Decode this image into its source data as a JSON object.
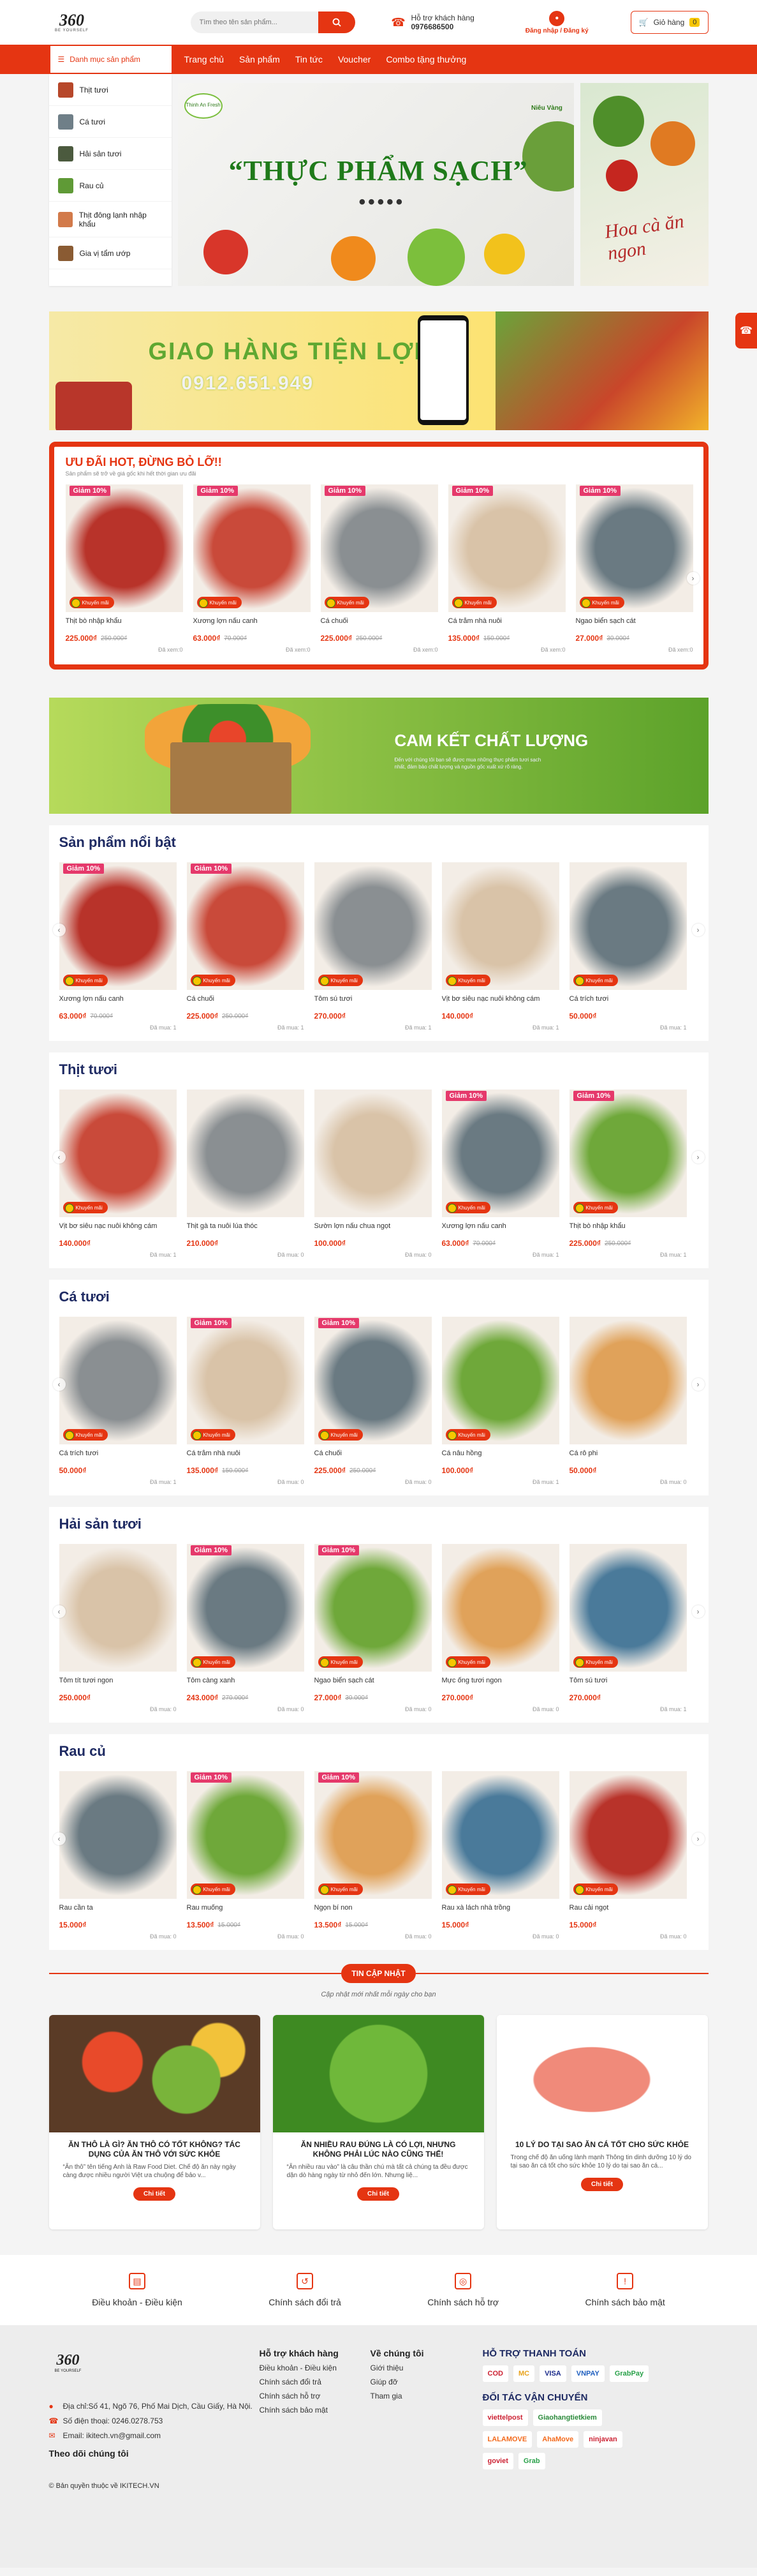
{
  "header": {
    "logo_text": "360",
    "logo_tagline": "BE YOURSELF",
    "search_placeholder": "Tìm theo tên sản phẩm...",
    "support_label": "Hỗ trợ khách hàng",
    "support_phone": "0976686500",
    "login_label": "Đăng nhập / Đăng ký",
    "cart_label": "Giỏ hàng",
    "cart_count": "0"
  },
  "nav": {
    "category_button": "Danh mục sản phẩm",
    "menu": [
      "Trang chủ",
      "Sản phẩm",
      "Tin tức",
      "Voucher",
      "Combo tặng thưởng"
    ]
  },
  "sidebar_categories": [
    "Thịt tươi",
    "Cá tươi",
    "Hải sản tươi",
    "Rau củ",
    "Thịt đông lạnh nhập khẩu",
    "Gia vị tẩm ướp"
  ],
  "hero": {
    "headline": "“THỰC PHẨM SẠCH”",
    "dots": "•••••",
    "brand_left": "Thinh An Fresh",
    "brand_right": "Niêu Vàng",
    "side_text": "Hoa cà ăn ngon"
  },
  "delivery_banner": {
    "title": "GIAO HÀNG TIỆN LỢI",
    "phone": "0912.651.949"
  },
  "deal": {
    "title": "ƯU ĐÃI HOT, ĐỪNG BỎ LỠ!!",
    "subtitle": "Sản phẩm sẽ trở về giá gốc khi hết thời gian ưu đãi",
    "products": [
      {
        "name": "Thịt bò nhập khẩu",
        "price": "225.000₫",
        "old": "250.000₫",
        "discount": "Giảm 10%",
        "badge": "Khuyến mãi",
        "sold": "Đã xem:0"
      },
      {
        "name": "Xương lợn nấu canh",
        "price": "63.000₫",
        "old": "70.000₫",
        "discount": "Giảm 10%",
        "badge": "Khuyến mãi",
        "sold": "Đã xem:0"
      },
      {
        "name": "Cá chuối",
        "price": "225.000₫",
        "old": "250.000₫",
        "discount": "Giảm 10%",
        "badge": "Khuyến mãi",
        "sold": "Đã xem:0"
      },
      {
        "name": "Cá trắm nhà nuôi",
        "price": "135.000₫",
        "old": "150.000₫",
        "discount": "Giảm 10%",
        "badge": "Khuyến mãi",
        "sold": "Đã xem:0"
      },
      {
        "name": "Ngao biển sạch cát",
        "price": "27.000₫",
        "old": "30.000₫",
        "discount": "Giảm 10%",
        "badge": "Khuyến mãi",
        "sold": "Đã xem:0"
      }
    ]
  },
  "quality_banner": {
    "title": "CAM KẾT CHẤT LƯỢNG",
    "desc": "Đến với chúng tôi bạn sẽ được mua những thực phẩm tươi sạch nhất, đảm bảo chất lượng và nguồn gốc xuất xứ rõ ràng."
  },
  "sections": [
    {
      "title": "Sản phẩm nổi bật",
      "products": [
        {
          "name": "Xương lợn nấu canh",
          "price": "63.000₫",
          "old": "70.000₫",
          "discount": "Giảm 10%",
          "badge": "Khuyến mãi",
          "cat": "Đã mua: 1"
        },
        {
          "name": "Cá chuối",
          "price": "225.000₫",
          "old": "250.000₫",
          "discount": "Giảm 10%",
          "badge": "Khuyến mãi",
          "cat": "Đã mua: 1"
        },
        {
          "name": "Tôm sú tươi",
          "price": "270.000₫",
          "old": "",
          "discount": "",
          "badge": "Khuyến mãi",
          "cat": "Đã mua: 1"
        },
        {
          "name": "Vịt bơ siêu nạc nuôi không cám",
          "price": "140.000₫",
          "old": "",
          "discount": "",
          "badge": "Khuyến mãi",
          "cat": "Đã mua: 1"
        },
        {
          "name": "Cá trích tươi",
          "price": "50.000₫",
          "old": "",
          "discount": "",
          "badge": "Khuyến mãi",
          "cat": "Đã mua: 1"
        }
      ]
    },
    {
      "title": "Thịt tươi",
      "products": [
        {
          "name": "Vịt bơ siêu nạc nuôi không cám",
          "price": "140.000₫",
          "old": "",
          "discount": "",
          "badge": "Khuyến mãi",
          "cat": "Đã mua: 1"
        },
        {
          "name": "Thịt gà ta nuôi lúa thóc",
          "price": "210.000₫",
          "old": "",
          "discount": "",
          "badge": "",
          "cat": "Đã mua: 0"
        },
        {
          "name": "Sườn lợn nấu chua ngọt",
          "price": "100.000₫",
          "old": "",
          "discount": "",
          "badge": "",
          "cat": "Đã mua: 0"
        },
        {
          "name": "Xương lợn nấu canh",
          "price": "63.000₫",
          "old": "70.000₫",
          "discount": "Giảm 10%",
          "badge": "Khuyến mãi",
          "cat": "Đã mua: 1"
        },
        {
          "name": "Thịt bò nhập khẩu",
          "price": "225.000₫",
          "old": "250.000₫",
          "discount": "Giảm 10%",
          "badge": "Khuyến mãi",
          "cat": "Đã mua: 1"
        }
      ]
    },
    {
      "title": "Cá tươi",
      "products": [
        {
          "name": "Cá trích tươi",
          "price": "50.000₫",
          "old": "",
          "discount": "",
          "badge": "Khuyến mãi",
          "cat": "Đã mua: 1"
        },
        {
          "name": "Cá trắm nhà nuôi",
          "price": "135.000₫",
          "old": "150.000₫",
          "discount": "Giảm 10%",
          "badge": "Khuyến mãi",
          "cat": "Đã mua: 0"
        },
        {
          "name": "Cá chuối",
          "price": "225.000₫",
          "old": "250.000₫",
          "discount": "Giảm 10%",
          "badge": "Khuyến mãi",
          "cat": "Đã mua: 0"
        },
        {
          "name": "Cá nâu hồng",
          "price": "100.000₫",
          "old": "",
          "discount": "",
          "badge": "Khuyến mãi",
          "cat": "Đã mua: 1"
        },
        {
          "name": "Cá rô phi",
          "price": "50.000₫",
          "old": "",
          "discount": "",
          "badge": "",
          "cat": "Đã mua: 0"
        }
      ]
    },
    {
      "title": "Hải sản tươi",
      "products": [
        {
          "name": "Tôm tít tươi ngon",
          "price": "250.000₫",
          "old": "",
          "discount": "",
          "badge": "",
          "cat": "Đã mua: 0"
        },
        {
          "name": "Tôm càng xanh",
          "price": "243.000₫",
          "old": "270.000₫",
          "discount": "Giảm 10%",
          "badge": "Khuyến mãi",
          "cat": "Đã mua: 0"
        },
        {
          "name": "Ngao biển sạch cát",
          "price": "27.000₫",
          "old": "30.000₫",
          "discount": "Giảm 10%",
          "badge": "Khuyến mãi",
          "cat": "Đã mua: 0"
        },
        {
          "name": "Mực ống tươi ngon",
          "price": "270.000₫",
          "old": "",
          "discount": "",
          "badge": "Khuyến mãi",
          "cat": "Đã mua: 0"
        },
        {
          "name": "Tôm sú tươi",
          "price": "270.000₫",
          "old": "",
          "discount": "",
          "badge": "Khuyến mãi",
          "cat": "Đã mua: 1"
        }
      ]
    },
    {
      "title": "Rau củ",
      "products": [
        {
          "name": "Rau cần ta",
          "price": "15.000₫",
          "old": "",
          "discount": "",
          "badge": "",
          "cat": "Đã mua: 0"
        },
        {
          "name": "Rau muống",
          "price": "13.500₫",
          "old": "15.000₫",
          "discount": "Giảm 10%",
          "badge": "Khuyến mãi",
          "cat": "Đã mua: 0"
        },
        {
          "name": "Ngọn bí non",
          "price": "13.500₫",
          "old": "15.000₫",
          "discount": "Giảm 10%",
          "badge": "Khuyến mãi",
          "cat": "Đã mua: 0"
        },
        {
          "name": "Rau xà lách nhà trồng",
          "price": "15.000₫",
          "old": "",
          "discount": "",
          "badge": "Khuyến mãi",
          "cat": "Đã mua: 0"
        },
        {
          "name": "Rau cải ngọt",
          "price": "15.000₫",
          "old": "",
          "discount": "",
          "badge": "Khuyến mãi",
          "cat": "Đã mua: 0"
        }
      ]
    }
  ],
  "news": {
    "badge": "TIN CẬP NHẬT",
    "subtitle": "Cập nhật mới nhất mỗi ngày cho bạn",
    "read_more": "Chi tiết",
    "items": [
      {
        "title": "ĂN THÔ LÀ GÌ? ĂN THÔ CÓ TỐT KHÔNG? TÁC DỤNG CỦA ĂN THÔ VỚI SỨC KHỎE",
        "desc": "“Ăn thô” tên tiếng Anh là Raw Food Diet. Chế độ ăn này ngày càng được nhiều người Việt ưa chuộng để bảo v..."
      },
      {
        "title": "ĂN NHIỀU RAU ĐÚNG LÀ CÓ LỢI, NHƯNG KHÔNG PHẢI LÚC NÀO CŨNG THẾ!",
        "desc": "“Ăn nhiều rau vào” là câu thần chú mà tất cả chúng ta đều được dặn dò hàng ngày từ nhỏ đến lớn. Nhưng liệ..."
      },
      {
        "title": "10 LÝ DO TẠI SAO ĂN CÁ TỐT CHO SỨC KHỎE",
        "desc": "Trong chế độ ăn uống lành mạnh Thông tin dinh dưỡng 10 lý do tại sao ăn cá tốt cho sức khỏe 10 lý do tại sao ăn cá..."
      }
    ]
  },
  "policies": [
    "Điều khoản - Điều kiện",
    "Chính sách đổi trả",
    "Chính sách hỗ trợ",
    "Chính sách bảo mật"
  ],
  "footer": {
    "address": "Địa chỉ:Số 41, Ngõ 76, Phố Mai Dịch, Cầu Giấy, Hà Nội.",
    "phone": "Số điện thoại: 0246.0278.753",
    "email": "Email: ikitech.vn@gmail.com",
    "follow": "Theo dõi chúng tôi",
    "col1_title": "Hỗ trợ khách hàng",
    "col1_links": [
      "Điều khoản - Điều kiện",
      "Chính sách đổi trả",
      "Chính sách hỗ trợ",
      "Chính sách bảo mật"
    ],
    "col2_title": "Về chúng tôi",
    "col2_links": [
      "Giới thiệu",
      "Giúp đỡ",
      "Tham gia"
    ],
    "pay_title": "HỖ TRỢ THANH TOÁN",
    "pay_logos": [
      "COD",
      "MC",
      "VISA",
      "VNPAY",
      "GrabPay"
    ],
    "ship_title": "ĐỐI TÁC VẬN CHUYỂN",
    "ship_logos": [
      "viettelpost",
      "Giaohangtietkiem",
      "LALAMOVE",
      "AhaMove",
      "ninjavan",
      "goviet",
      "Grab"
    ],
    "copyright": "© Bản quyền thuộc về IKITECH.VN"
  }
}
